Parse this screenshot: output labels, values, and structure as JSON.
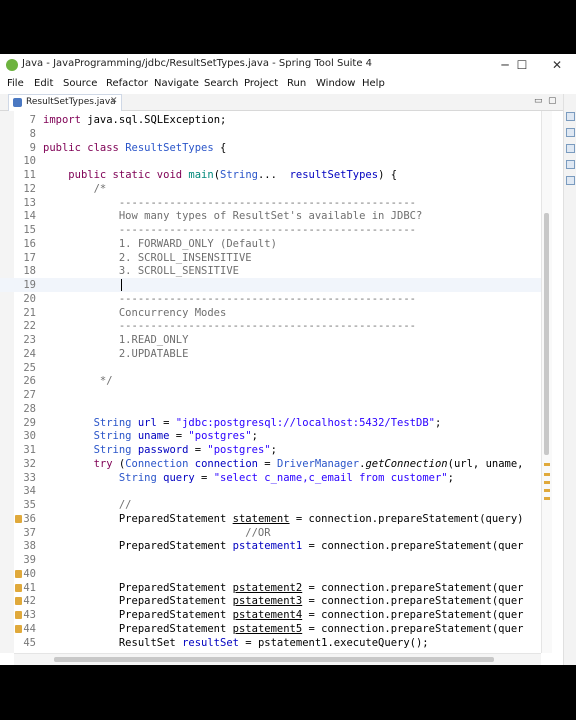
{
  "window": {
    "title": "Java - JavaProgramming/jdbc/ResultSetTypes.java - Spring Tool Suite 4",
    "minimize_icon": "─",
    "maximize_icon": "☐",
    "close_icon": "✕"
  },
  "menu": [
    "File",
    "Edit",
    "Source",
    "Refactor",
    "Navigate",
    "Search",
    "Project",
    "Run",
    "Window",
    "Help"
  ],
  "tab": {
    "label": "ResultSetTypes.java",
    "close": "✕"
  },
  "toolbar_right": {
    "minimize": "▭",
    "maximize": "▢"
  },
  "editor": {
    "lines": [
      {
        "n": "7",
        "tokens": [
          [
            "k",
            "import"
          ],
          [
            "",
            " java.sql.SQLException;"
          ]
        ]
      },
      {
        "n": "8",
        "tokens": []
      },
      {
        "n": "9",
        "tokens": [
          [
            "k",
            "public class "
          ],
          [
            "t",
            "ResultSetTypes"
          ],
          [
            "",
            " {"
          ]
        ]
      },
      {
        "n": "10",
        "tokens": []
      },
      {
        "n": "11",
        "tokens": [
          [
            "",
            "    "
          ],
          [
            "k",
            "public static void "
          ],
          [
            "f",
            "main"
          ],
          [
            "",
            "("
          ],
          [
            "t",
            "String"
          ],
          [
            "",
            "...  "
          ],
          [
            "v",
            "resultSetTypes"
          ],
          [
            "",
            ") {"
          ]
        ]
      },
      {
        "n": "12",
        "tokens": [
          [
            "c",
            "        /*"
          ]
        ]
      },
      {
        "n": "13",
        "tokens": [
          [
            "c",
            "            -----------------------------------------------"
          ]
        ]
      },
      {
        "n": "14",
        "tokens": [
          [
            "c",
            "            How many types of ResultSet's available in JDBC?"
          ]
        ]
      },
      {
        "n": "15",
        "tokens": [
          [
            "c",
            "            -----------------------------------------------"
          ]
        ]
      },
      {
        "n": "16",
        "tokens": [
          [
            "c",
            "            1. FORWARD_ONLY (Default)"
          ]
        ]
      },
      {
        "n": "17",
        "tokens": [
          [
            "c",
            "            2. SCROLL_INSENSITIVE"
          ]
        ]
      },
      {
        "n": "18",
        "tokens": [
          [
            "c",
            "            3. SCROLL_SENSITIVE"
          ]
        ]
      },
      {
        "n": "19",
        "tokens": []
      },
      {
        "n": "20",
        "tokens": [
          [
            "c",
            "            -----------------------------------------------"
          ]
        ]
      },
      {
        "n": "21",
        "tokens": [
          [
            "c",
            "            Concurrency Modes"
          ]
        ]
      },
      {
        "n": "22",
        "tokens": [
          [
            "c",
            "            -----------------------------------------------"
          ]
        ]
      },
      {
        "n": "23",
        "tokens": [
          [
            "c",
            "            1.READ_ONLY"
          ]
        ]
      },
      {
        "n": "24",
        "tokens": [
          [
            "c",
            "            2.UPDATABLE"
          ]
        ]
      },
      {
        "n": "25",
        "tokens": []
      },
      {
        "n": "26",
        "tokens": [
          [
            "c",
            "         */"
          ]
        ]
      },
      {
        "n": "27",
        "tokens": []
      },
      {
        "n": "28",
        "tokens": []
      },
      {
        "n": "29",
        "tokens": [
          [
            "",
            "        "
          ],
          [
            "t",
            "String"
          ],
          [
            "",
            " "
          ],
          [
            "v",
            "url"
          ],
          [
            "",
            " = "
          ],
          [
            "s",
            "\"jdbc:postgresql://localhost:5432/TestDB\""
          ],
          [
            "",
            ";"
          ]
        ]
      },
      {
        "n": "30",
        "tokens": [
          [
            "",
            "        "
          ],
          [
            "t",
            "String"
          ],
          [
            "",
            " "
          ],
          [
            "v",
            "uname"
          ],
          [
            "",
            " = "
          ],
          [
            "s",
            "\"postgres\""
          ],
          [
            "",
            ";"
          ]
        ]
      },
      {
        "n": "31",
        "tokens": [
          [
            "",
            "        "
          ],
          [
            "t",
            "String"
          ],
          [
            "",
            " "
          ],
          [
            "v",
            "password"
          ],
          [
            "",
            " = "
          ],
          [
            "s",
            "\"postgres\""
          ],
          [
            "",
            ";"
          ]
        ]
      },
      {
        "n": "32",
        "tokens": [
          [
            "",
            "        "
          ],
          [
            "k",
            "try"
          ],
          [
            "",
            " ("
          ],
          [
            "t",
            "Connection"
          ],
          [
            "",
            " "
          ],
          [
            "v",
            "connection"
          ],
          [
            "",
            " = "
          ],
          [
            "t",
            "DriverManager"
          ],
          [
            "",
            "."
          ],
          [
            "m",
            "getConnection"
          ],
          [
            "",
            "(url, uname,"
          ]
        ]
      },
      {
        "n": "33",
        "tokens": [
          [
            "",
            "            "
          ],
          [
            "t",
            "String"
          ],
          [
            "",
            " "
          ],
          [
            "v",
            "query"
          ],
          [
            "",
            " = "
          ],
          [
            "s",
            "\"select c_name,c_email from customer\""
          ],
          [
            "",
            ";"
          ]
        ]
      },
      {
        "n": "34",
        "tokens": []
      },
      {
        "n": "35",
        "tokens": [
          [
            "c",
            "            //"
          ]
        ]
      },
      {
        "n": "36",
        "tokens": [
          [
            "",
            "            PreparedStatement "
          ],
          [
            "u",
            "statement"
          ],
          [
            "",
            " = connection.prepareStatement(query)"
          ]
        ]
      },
      {
        "n": "37",
        "tokens": [
          [
            "c",
            "                                //OR"
          ]
        ]
      },
      {
        "n": "38",
        "tokens": [
          [
            "",
            "            PreparedStatement "
          ],
          [
            "v",
            "pstatement1"
          ],
          [
            "",
            " = connection.prepareStatement(quer"
          ]
        ]
      },
      {
        "n": "39",
        "tokens": []
      },
      {
        "n": "40",
        "tokens": []
      },
      {
        "n": "41",
        "tokens": [
          [
            "",
            "            PreparedStatement "
          ],
          [
            "u",
            "pstatement2"
          ],
          [
            "",
            " = connection.prepareStatement(quer"
          ]
        ]
      },
      {
        "n": "42",
        "tokens": [
          [
            "",
            "            PreparedStatement "
          ],
          [
            "u",
            "pstatement3"
          ],
          [
            "",
            " = connection.prepareStatement(quer"
          ]
        ]
      },
      {
        "n": "43",
        "tokens": [
          [
            "",
            "            PreparedStatement "
          ],
          [
            "u",
            "pstatement4"
          ],
          [
            "",
            " = connection.prepareStatement(quer"
          ]
        ]
      },
      {
        "n": "44",
        "tokens": [
          [
            "",
            "            PreparedStatement "
          ],
          [
            "u",
            "pstatement5"
          ],
          [
            "",
            " = connection.prepareStatement(quer"
          ]
        ]
      },
      {
        "n": "45",
        "tokens": [
          [
            "",
            "            ResultSet "
          ],
          [
            "v",
            "resultSet"
          ],
          [
            "",
            " = pstatement1.executeQuery();"
          ]
        ]
      }
    ]
  },
  "colors": {
    "keyword": "#7f0055",
    "type": "#2a55c9",
    "string": "#2a00ff",
    "variable": "#0000c0",
    "comment": "#6f6f6f",
    "method": "#00897b",
    "warning_marker": "#e0a93b"
  },
  "icons": {
    "app": "spring-tool-suite-icon",
    "file": "java-file-icon",
    "warning": "warning-marker-icon"
  }
}
